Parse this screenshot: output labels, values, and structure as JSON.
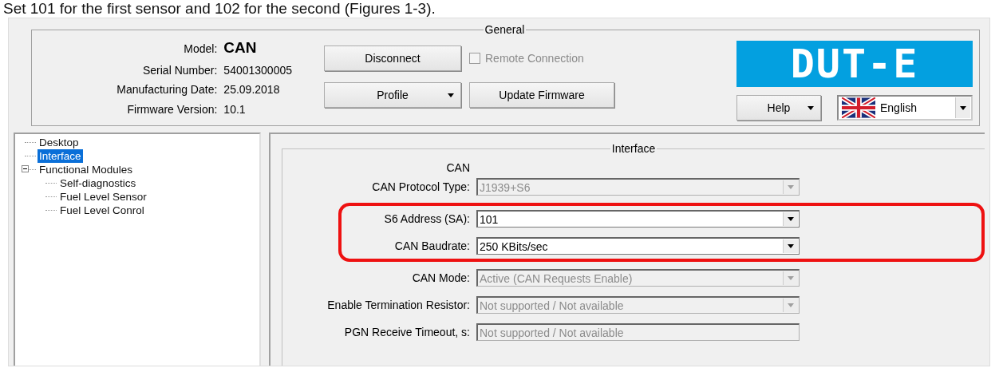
{
  "caption": "Set 101 for the first sensor and 102 for the second (Figures 1-3).",
  "general": {
    "title": "General",
    "info": [
      {
        "kind": "title",
        "label": "Model:",
        "value": "CAN"
      },
      {
        "kind": "plain",
        "label": "Serial Number:",
        "value": "54001300005"
      },
      {
        "kind": "plain",
        "label": "Manufacturing Date:",
        "value": "25.09.2018"
      },
      {
        "kind": "plain",
        "label": "Firmware Version:",
        "value": "10.1"
      }
    ],
    "disconnect": {
      "label": "Disconnect",
      "dropdown": false
    },
    "profile": {
      "label": "Profile",
      "dropdown": true
    },
    "remote": {
      "label": "Remote Connection",
      "checked": false,
      "disabled": true
    },
    "update": {
      "label": "Update Firmware",
      "dropdown": false
    },
    "logo": {
      "text": "DUT-E"
    },
    "help": {
      "label": "Help",
      "dropdown": true
    },
    "language": {
      "value": "English"
    }
  },
  "tree": [
    {
      "label": "Desktop",
      "selected": false
    },
    {
      "label": "Interface",
      "selected": true
    },
    {
      "label": "Functional Modules",
      "selected": false,
      "expanded": true,
      "children": [
        {
          "label": "Self-diagnostics",
          "selected": false
        },
        {
          "label": "Fuel Level Sensor",
          "selected": false
        },
        {
          "label": "Fuel Level Conrol",
          "selected": false
        }
      ]
    }
  ],
  "interface": {
    "title": "Interface",
    "section": "CAN",
    "fields": [
      {
        "label": "CAN Protocol Type:",
        "kind": "combo",
        "value": "J1939+S6",
        "disabled": true,
        "highlighted": false
      },
      {
        "label": "S6 Address (SA):",
        "kind": "combo",
        "value": "101",
        "disabled": false,
        "highlighted": true
      },
      {
        "label": "CAN Baudrate:",
        "kind": "combo",
        "value": "250 KBits/sec",
        "disabled": false,
        "highlighted": true
      },
      {
        "label": "CAN Mode:",
        "kind": "combo",
        "value": "Active (CAN Requests Enable)",
        "disabled": true,
        "highlighted": false
      },
      {
        "label": "Enable Termination Resistor:",
        "kind": "combo",
        "value": "Not supported / Not available",
        "disabled": true,
        "highlighted": false
      },
      {
        "label": "PGN Receive Timeout, s:",
        "kind": "text",
        "value": "Not supported / Not available",
        "disabled": true,
        "highlighted": false
      }
    ]
  }
}
